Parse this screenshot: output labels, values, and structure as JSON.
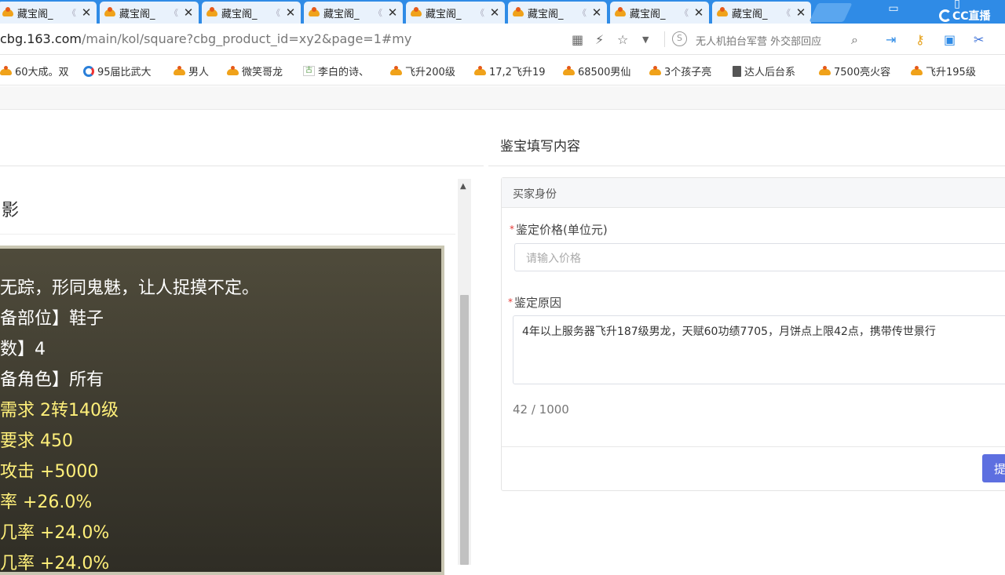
{
  "tabs": [
    {
      "title": "藏宝阁_"
    },
    {
      "title": "藏宝阁_"
    },
    {
      "title": "藏宝阁_"
    },
    {
      "title": "藏宝阁_"
    },
    {
      "title": "藏宝阁_"
    },
    {
      "title": "藏宝阁_"
    },
    {
      "title": "藏宝阁_"
    },
    {
      "title": "藏宝阁_"
    }
  ],
  "tab_arrow": "《",
  "close_glyph": "✕",
  "cc_logo": "CC直播",
  "address": {
    "url_host": "cbg.163.com",
    "url_path": "/main/kol/square?cbg_product_id=xy2&page=1#my",
    "search_hint": "无人机拍台军营 外交部回应"
  },
  "bookmarks": [
    {
      "label": "60大成。双",
      "icon": "cat"
    },
    {
      "label": "95届比武大",
      "icon": "g"
    },
    {
      "label": "男人",
      "icon": "cat"
    },
    {
      "label": "微笑哥龙",
      "icon": "cat"
    },
    {
      "label": "李白的诗、",
      "icon": "gu"
    },
    {
      "label": "飞升200级",
      "icon": "cat"
    },
    {
      "label": "17,2飞升19",
      "icon": "cat"
    },
    {
      "label": "68500男仙",
      "icon": "cat"
    },
    {
      "label": "3个孩子亮",
      "icon": "cat"
    },
    {
      "label": "达人后台系",
      "icon": "doc"
    },
    {
      "label": "7500亮火容",
      "icon": "cat"
    },
    {
      "label": "飞升195级",
      "icon": "cat"
    }
  ],
  "left": {
    "title": "影",
    "tooltip_lines": [
      {
        "text": "无踪，形同鬼魅，让人捉摸不定。",
        "color": "white"
      },
      {
        "text": "备部位】鞋子",
        "color": "white"
      },
      {
        "text": "数】4",
        "color": "white"
      },
      {
        "text": "备角色】所有",
        "color": "white"
      },
      {
        "text": "需求 2转140级",
        "color": "yellow"
      },
      {
        "text": "要求 450",
        "color": "yellow"
      },
      {
        "text": "攻击 +5000",
        "color": "yellow"
      },
      {
        "text": "率 +26.0%",
        "color": "yellow"
      },
      {
        "text": "几率 +24.0%",
        "color": "yellow"
      },
      {
        "text": "几率 +24.0%",
        "color": "yellow"
      }
    ]
  },
  "right": {
    "section_title": "鉴宝填写内容",
    "panel_title": "买家身份",
    "price_label": "鉴定价格(单位元)",
    "price_placeholder": "请输入价格",
    "reason_label": "鉴定原因",
    "reason_value": "4年以上服务器飞升187级男龙，天赋60功绩7705，月饼点上限42点，携带传世景行",
    "char_count": "42 / 1000",
    "submit_label": "提",
    "required_mark": "*"
  },
  "colors": {
    "tabbar": "#2f8be6",
    "submit": "#5d6fe0",
    "tooltip_yellow": "#fff07a"
  }
}
